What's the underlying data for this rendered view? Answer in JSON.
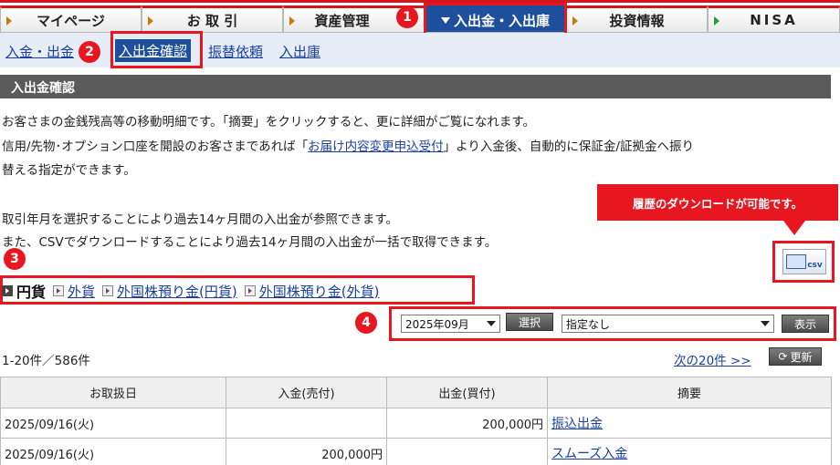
{
  "nav": {
    "tabs": [
      {
        "label": "マイページ"
      },
      {
        "label": "お 取 引"
      },
      {
        "label": "資産管理"
      },
      {
        "label": "入出金・入出庫"
      },
      {
        "label": "投資情報"
      },
      {
        "label": "NISA"
      }
    ]
  },
  "subnav": {
    "items": [
      {
        "label": "入金・出金"
      },
      {
        "label": "入出金確認"
      },
      {
        "label": "振替依頼"
      },
      {
        "label": "入出庫"
      }
    ]
  },
  "section": {
    "title": "入出金確認"
  },
  "intro": {
    "line1": "お客さまの金銭残高等の移動明細です。「摘要」をクリックすると、更に詳細がご覧になれます。",
    "line2_pre": "信用/先物･オプション口座を開設のお客さまであれば「",
    "line2_link": "お届け内容変更申込受付",
    "line2_post": "」より入金後、自動的に保証金/証拠金へ振り",
    "line3": "替える指定ができます。",
    "line4": "取引年月を選択することにより過去14ヶ月間の入出金が参照できます。",
    "line5": "また、CSVでダウンロードすることにより過去14ヶ月間の入出金が一括で取得できます。"
  },
  "callout": {
    "text": "履歴のダウンロードが可能です。"
  },
  "csv_button": {
    "label": "csv"
  },
  "markers": [
    "1",
    "2",
    "3",
    "4"
  ],
  "currency_tabs": [
    {
      "label": "円貨",
      "selected": true
    },
    {
      "label": "外貨",
      "selected": false
    },
    {
      "label": "外国株預り金(円貨)",
      "selected": false
    },
    {
      "label": "外国株預り金(外貨)",
      "selected": false
    }
  ],
  "filter": {
    "month_value": "2025年09月",
    "select_button": "選択",
    "type_value": "指定なし",
    "show_button": "表示"
  },
  "list": {
    "count": "1-20件／586件",
    "next_link": "次の20件 >>",
    "refresh": "更新"
  },
  "table": {
    "headers": [
      "お取扱日",
      "入金(売付)",
      "出金(買付)",
      "摘要"
    ],
    "rows": [
      {
        "date": "2025/09/16(火)",
        "deposit": "",
        "withdrawal": "200,000円",
        "summary": "振込出金"
      },
      {
        "date": "2025/09/16(火)",
        "deposit": "200,000円",
        "withdrawal": "",
        "summary": "スムーズ入金"
      }
    ]
  },
  "colors": {
    "accent_red": "#e8161f",
    "nav_blue": "#1e4f9c",
    "link_blue": "#1a3fa0"
  }
}
